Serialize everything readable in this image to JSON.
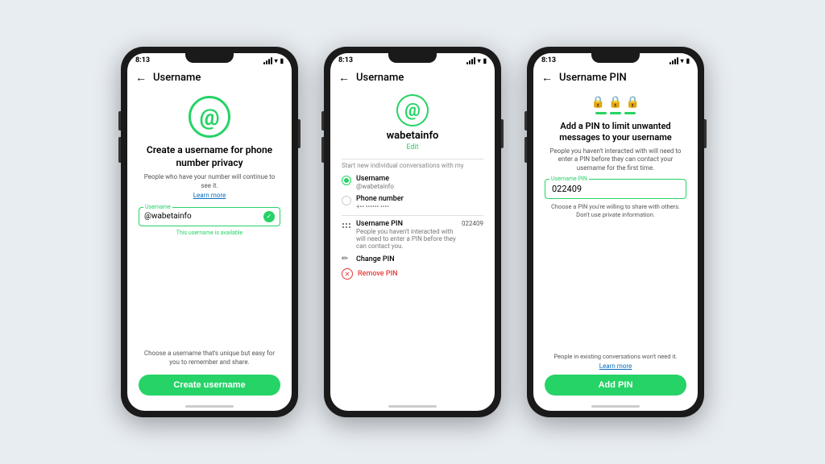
{
  "background_color": "#e8edf2",
  "brand_color": "#25d366",
  "phone1": {
    "status_time": "8:13",
    "header_back": "←",
    "header_title": "Username",
    "at_symbol": "@",
    "title": "Create a username for phone number privacy",
    "subtitle": "People who have your number will continue to see it.",
    "learn_more": "Learn more",
    "input_label": "Username",
    "input_value": "@wabetainfo",
    "available_text": "This username is available",
    "bottom_hint": "Choose a username that's unique but easy for you to remember and share.",
    "create_button": "Create username"
  },
  "phone2": {
    "status_time": "8:13",
    "header_back": "←",
    "header_title": "Username",
    "at_symbol": "@",
    "username": "wabetainfo",
    "edit_label": "Edit",
    "section_label": "Start new individual conversations with my",
    "option1_title": "Username",
    "option1_subtitle": "@wabetainfo",
    "option1_selected": true,
    "option2_title": "Phone number",
    "option2_subtitle": "+•• •••••• ••••",
    "option2_selected": false,
    "pin_title": "Username PIN",
    "pin_subtitle": "People you haven't interacted with will need to enter a PIN before they can contact you.",
    "pin_value": "022409",
    "change_pin": "Change PIN",
    "remove_pin": "Remove PIN"
  },
  "phone3": {
    "status_time": "8:13",
    "header_back": "←",
    "header_title": "Username PIN",
    "lock_icons": [
      "🔒",
      "🔒",
      "🔒"
    ],
    "title": "Add a PIN to limit unwanted messages to your username",
    "subtitle": "People you haven't interacted with will need to enter a PIN before they can contact your username for the first time.",
    "input_label": "Username PIN",
    "input_value": "022409",
    "hint_line1": "Choose a PIN you're willing to share with others.",
    "hint_line2": "Don't use private information.",
    "bottom_note": "People in existing conversations won't need it.",
    "learn_more": "Learn more",
    "add_pin_button": "Add PIN"
  }
}
